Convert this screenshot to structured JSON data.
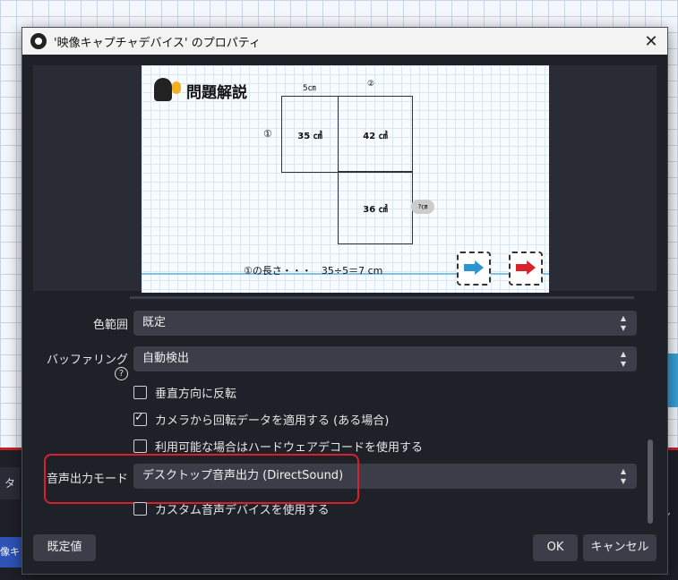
{
  "dialog": {
    "title": "'映像キャプチャデバイス' のプロパティ",
    "close": "✕"
  },
  "preview": {
    "heading": "問題解説",
    "top_label_1": "5㎝",
    "top_label_2": "②",
    "side_label": "①",
    "box1": "35 ㎠",
    "box2": "42 ㎠",
    "box3": "36 ㎠",
    "oval_label": "?㎝",
    "formula": "①の長さ・・・　35÷5＝7 cm"
  },
  "settings": {
    "color_range": {
      "label": "色範囲",
      "value": "既定"
    },
    "buffering": {
      "label": "バッファリング",
      "help": "?",
      "value": "自動検出"
    },
    "checkboxes": [
      {
        "label": "垂直方向に反転",
        "checked": false
      },
      {
        "label": "カメラから回転データを適用する (ある場合)",
        "checked": true
      },
      {
        "label": "利用可能な場合はハードウェアデコードを使用する",
        "checked": false
      }
    ],
    "audio_output": {
      "label": "音声出力モード",
      "value": "デスクトップ音声出力 (DirectSound)"
    },
    "custom_audio": {
      "label": "カスタム音声デバイスを使用する",
      "checked": false
    }
  },
  "buttons": {
    "defaults": "既定値",
    "ok": "OK",
    "cancel": "キャンセル"
  },
  "background": {
    "left_text": "タ",
    "left_tab": "像キャ",
    "right_text": "ン"
  }
}
